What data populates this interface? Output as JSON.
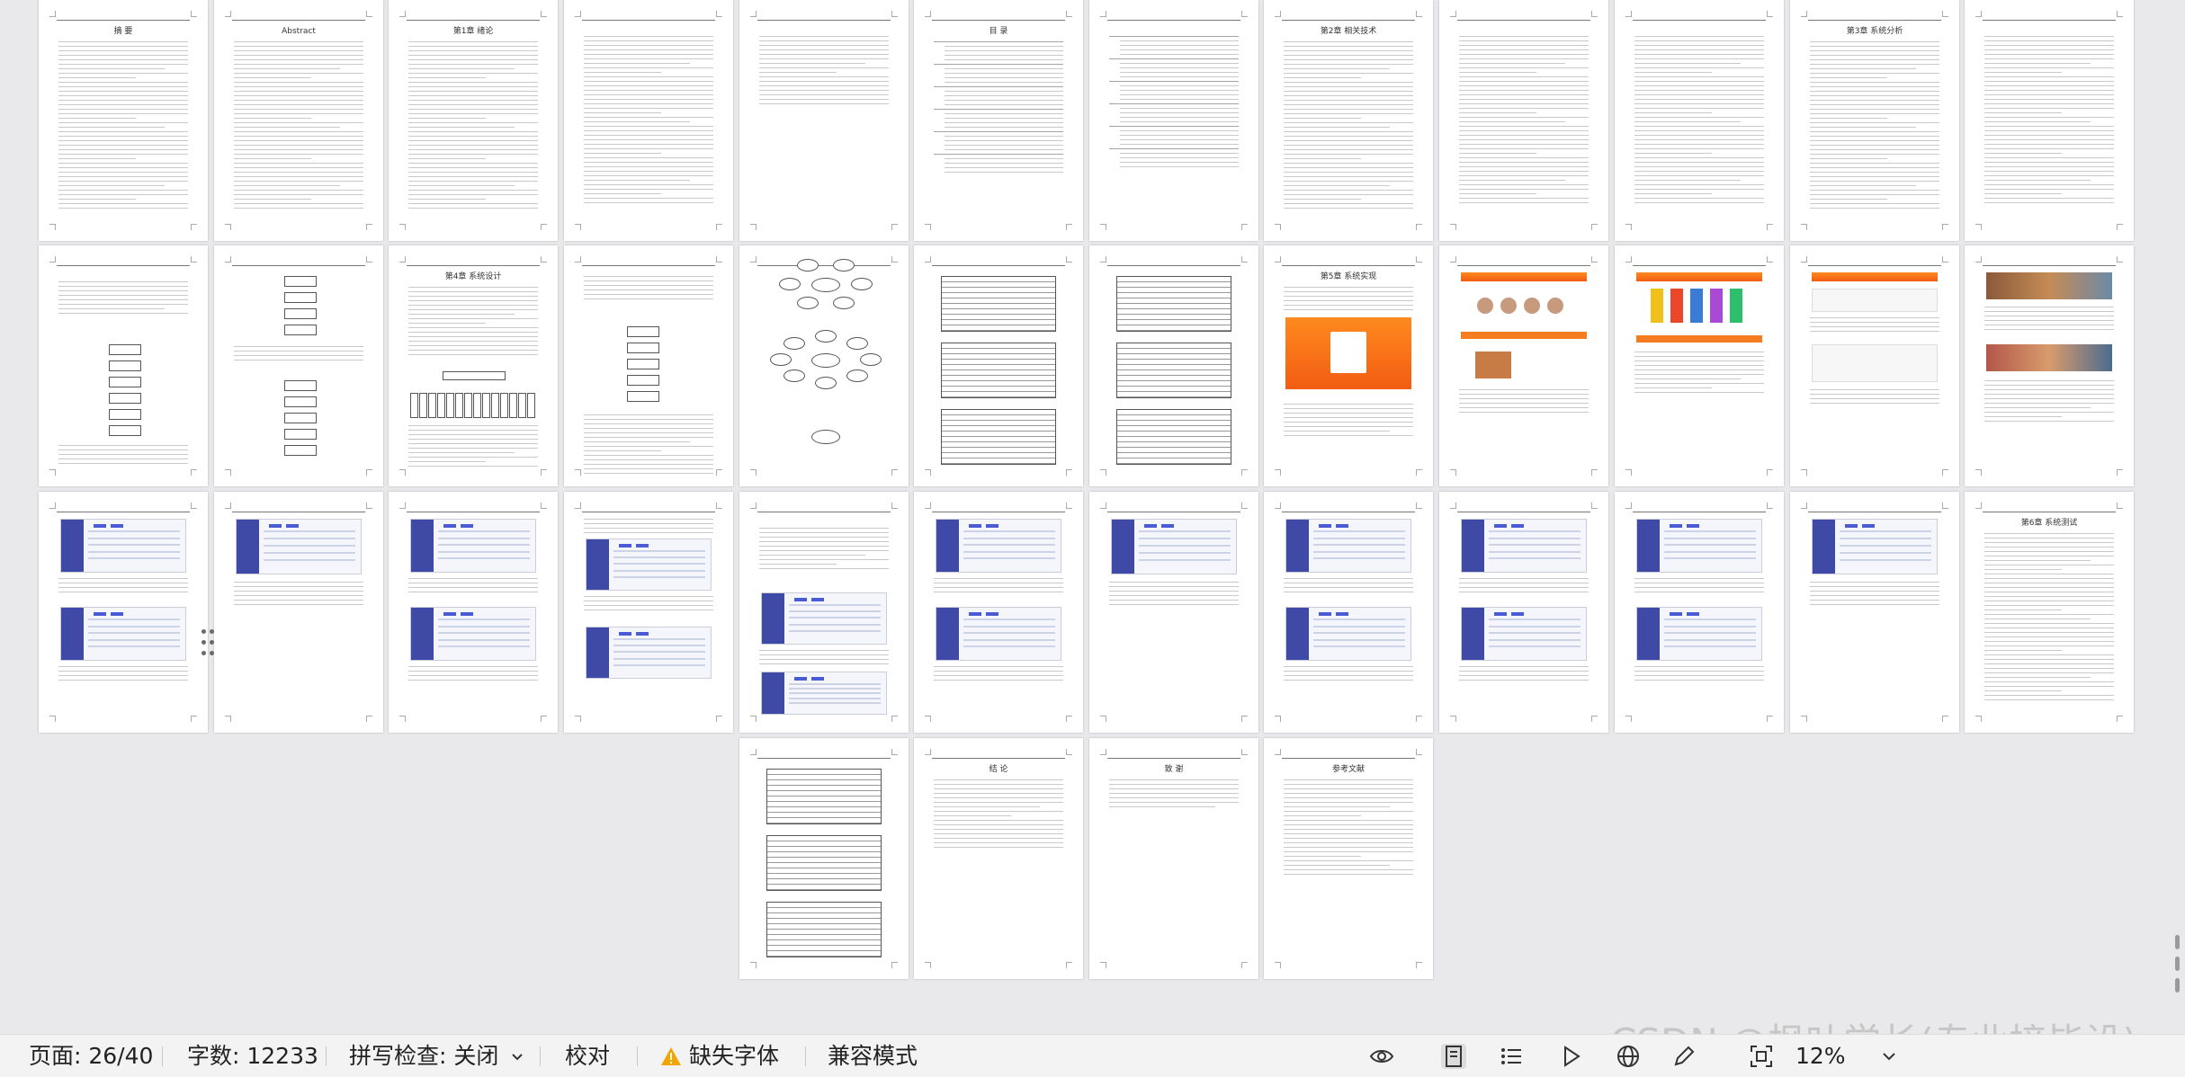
{
  "document": {
    "pages": [
      {
        "title": "摘  要",
        "kind": "text"
      },
      {
        "title": "Abstract",
        "kind": "text"
      },
      {
        "title": "第1章 绪论",
        "kind": "text"
      },
      {
        "title": "",
        "kind": "text"
      },
      {
        "title": "",
        "kind": "text-short"
      },
      {
        "title": "目  录",
        "kind": "toc"
      },
      {
        "title": "",
        "kind": "toc"
      },
      {
        "title": "第2章 相关技术",
        "kind": "text"
      },
      {
        "title": "",
        "kind": "text"
      },
      {
        "title": "",
        "kind": "text"
      },
      {
        "title": "第3章 系统分析",
        "kind": "text"
      },
      {
        "title": "",
        "kind": "text"
      },
      {
        "title": "",
        "kind": "flow"
      },
      {
        "title": "",
        "kind": "flow2"
      },
      {
        "title": "第4章 系统设计",
        "kind": "tree"
      },
      {
        "title": "",
        "kind": "flow3"
      },
      {
        "title": "",
        "kind": "er"
      },
      {
        "title": "",
        "kind": "tables"
      },
      {
        "title": "",
        "kind": "tables"
      },
      {
        "title": "第5章 系统实现",
        "kind": "login"
      },
      {
        "title": "",
        "kind": "web-avatars"
      },
      {
        "title": "",
        "kind": "web-products"
      },
      {
        "title": "",
        "kind": "web-form"
      },
      {
        "title": "",
        "kind": "web-gallery"
      },
      {
        "title": "",
        "kind": "admin2"
      },
      {
        "title": "",
        "kind": "admin1"
      },
      {
        "title": "",
        "kind": "admin2"
      },
      {
        "title": "",
        "kind": "admin3"
      },
      {
        "title": "",
        "kind": "admin-text"
      },
      {
        "title": "",
        "kind": "admin2"
      },
      {
        "title": "",
        "kind": "admin1"
      },
      {
        "title": "",
        "kind": "admin2"
      },
      {
        "title": "",
        "kind": "admin2"
      },
      {
        "title": "",
        "kind": "admin2"
      },
      {
        "title": "",
        "kind": "admin1"
      },
      {
        "title": "第6章 系统测试",
        "kind": "text"
      },
      {
        "title": "",
        "kind": "tables"
      },
      {
        "title": "结  论",
        "kind": "text-short"
      },
      {
        "title": "致  谢",
        "kind": "text-tiny"
      },
      {
        "title": "参考文献",
        "kind": "refs"
      }
    ]
  },
  "statusbar": {
    "page_label": "页面: 26/40",
    "word_count_label": "字数: 12233",
    "spell_check_label": "拼写检查: 关闭",
    "proofread_label": "校对",
    "missing_font_label": "缺失字体",
    "compat_mode_label": "兼容模式",
    "zoom_label": "12%"
  },
  "watermark": "CSDN @枫叶学长(专业接毕设)",
  "colors": {
    "accent_orange": "#f57c1f",
    "admin_sidebar": "#3f4aa6",
    "warning_yellow": "#f0a500",
    "background": "#e9e9eb"
  },
  "icons": [
    "eye-icon",
    "page-view-icon",
    "outline-icon",
    "play-icon",
    "globe-icon",
    "pen-icon",
    "fit-page-icon",
    "chevron-down-icon",
    "warning-icon"
  ]
}
